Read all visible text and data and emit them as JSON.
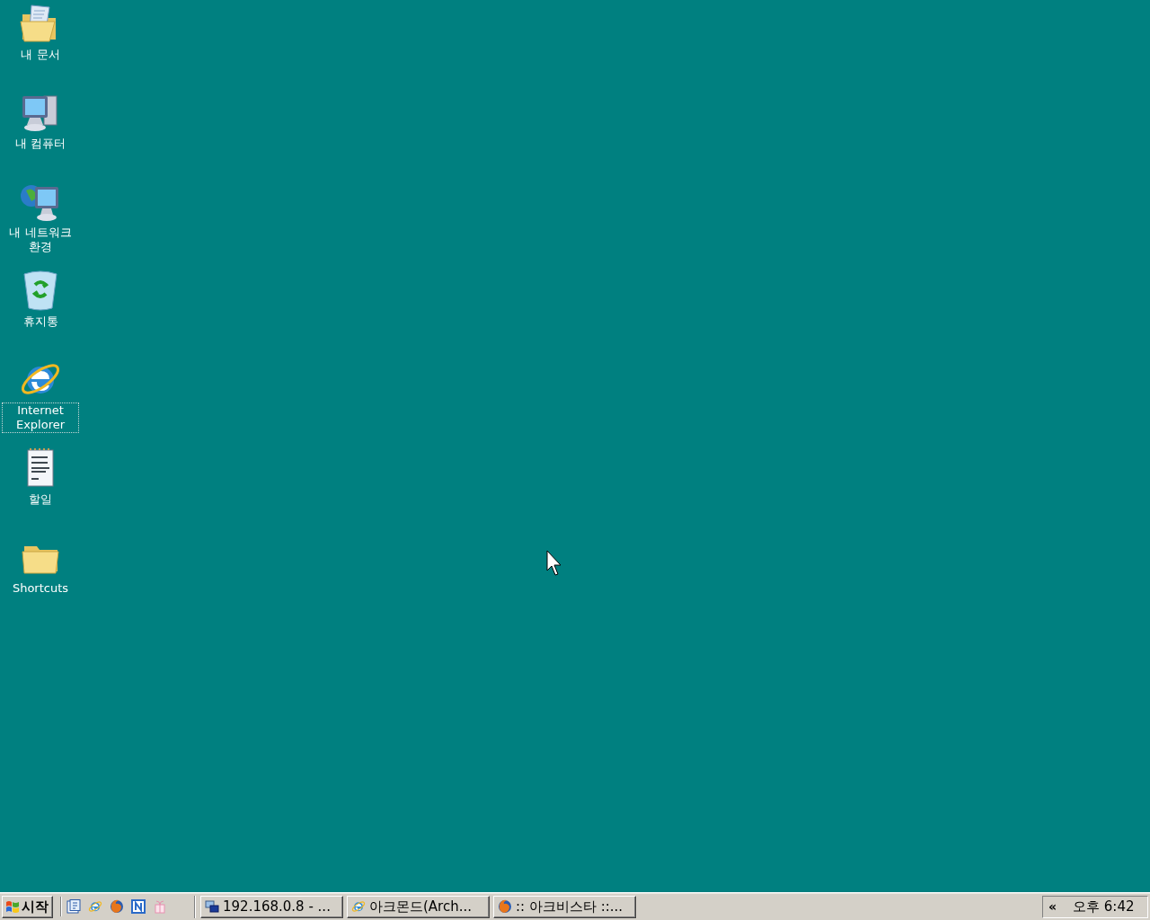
{
  "desktop_icons": [
    {
      "label": "내 문서",
      "kind": "documents",
      "selected": false
    },
    {
      "label": "내 컴퓨터",
      "kind": "computer",
      "selected": false
    },
    {
      "label": "내 네트워크 환경",
      "kind": "network",
      "selected": false
    },
    {
      "label": "휴지통",
      "kind": "recycle",
      "selected": false
    },
    {
      "label": "Internet Explorer",
      "kind": "browser",
      "selected": true
    },
    {
      "label": "할일",
      "kind": "notepad",
      "selected": false
    },
    {
      "label": "Shortcuts",
      "kind": "folder",
      "selected": false
    }
  ],
  "taskbar": {
    "start_button": "시작",
    "quick_launch": [
      {
        "kind": "desktop"
      },
      {
        "kind": "browser"
      },
      {
        "kind": "fox"
      },
      {
        "kind": "n-app"
      },
      {
        "kind": "gift"
      }
    ],
    "tasks": [
      {
        "label": "192.168.0.8 - ...",
        "kind": "remote"
      },
      {
        "label": "아크몬드(Arch...",
        "kind": "browser"
      },
      {
        "label": ":: 아크비스타 ::...",
        "kind": "fox"
      }
    ],
    "tray": {
      "expand": "«",
      "clock": "오후 6:42"
    }
  }
}
